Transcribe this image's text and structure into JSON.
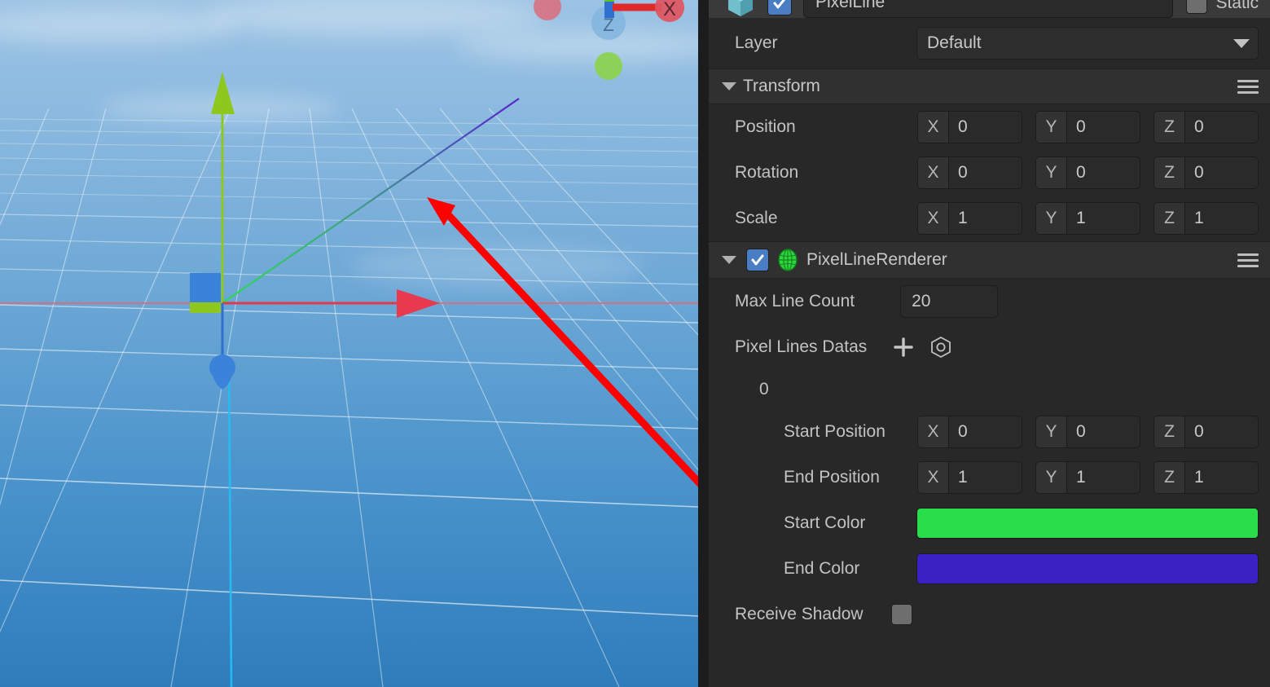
{
  "inspector": {
    "object_header": {
      "prefab_icon": "prefab-cube-icon",
      "enabled_label": "",
      "name_value": "PixelLine",
      "static_label": "Static",
      "static_checked": false
    },
    "layer_row": {
      "label": "Layer",
      "value": "Default"
    },
    "transform": {
      "title": "Transform",
      "rows": [
        {
          "label": "Position",
          "x": "0",
          "y": "0",
          "z": "0"
        },
        {
          "label": "Rotation",
          "x": "0",
          "y": "0",
          "z": "0"
        },
        {
          "label": "Scale",
          "x": "1",
          "y": "1",
          "z": "1"
        }
      ],
      "axis_labels": {
        "x": "X",
        "y": "Y",
        "z": "Z"
      }
    },
    "pixel_line_renderer": {
      "title": "PixelLineRenderer",
      "enabled": true,
      "max_line_count": {
        "label": "Max Line Count",
        "value": "20"
      },
      "pixel_lines_datas": {
        "label": "Pixel Lines Datas",
        "add_icon": "plus-icon",
        "target_icon": "target-hex-icon",
        "element_index": "0"
      },
      "start_position": {
        "label": "Start Position",
        "x": "0",
        "y": "0",
        "z": "0"
      },
      "end_position": {
        "label": "End Position",
        "x": "1",
        "y": "1",
        "z": "1"
      },
      "start_color": {
        "label": "Start Color",
        "value": "#2ade4b"
      },
      "end_color": {
        "label": "End Color",
        "value": "#3b21c4"
      },
      "receive_shadow": {
        "label": "Receive Shadow",
        "checked": false
      }
    }
  },
  "scene": {
    "gizmo": {
      "x_axis_label": "X",
      "z_axis_label": "Z",
      "x_color": "#d93c4a",
      "y_color": "#8ec81e",
      "z_color": "#2f86e0"
    },
    "rendered_line": {
      "start_color": "#2ade4b",
      "end_color": "#5b22c8"
    },
    "annotation_arrow_color": "#ff0000"
  },
  "colors": {
    "panel_bg": "#282828",
    "section_header_bg": "#303030",
    "field_bg": "#2a2a2a",
    "text": "#c3c3c3",
    "checkbox_blue": "#4a7ec4"
  }
}
